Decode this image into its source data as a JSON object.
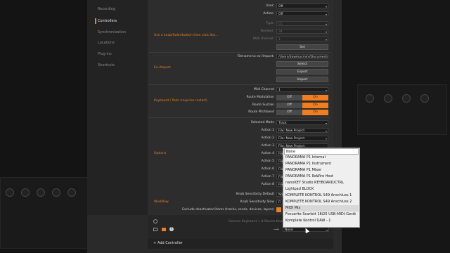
{
  "sidebar": {
    "items": [
      {
        "label": "Recording",
        "active": false
      },
      {
        "label": "Controllers",
        "active": true
      },
      {
        "label": "Synchronization",
        "active": false
      },
      {
        "label": "Locations",
        "active": false
      },
      {
        "label": "Plug-ins",
        "active": false
      },
      {
        "label": "Shortcuts",
        "active": false
      }
    ]
  },
  "learn": {
    "section": "Use a knob/fader/button then click Set...",
    "user_label": "User:",
    "user_value": "Off",
    "action_label": "Action:",
    "action_value": "Off",
    "type_label": "Type:",
    "type_value": "CC",
    "number_label": "Number:",
    "number_value": "34",
    "channel_label": "Midi channel:",
    "channel_value": "1",
    "set_button": "Set"
  },
  "exim": {
    "section": "Ex-/Import",
    "filename_label": "Filename to ex-/import:",
    "filename_value": "/Users/dawmacmini/Documents/",
    "select_button": "Select",
    "export_button": "Export",
    "import_button": "Import"
  },
  "keyboard": {
    "section": "Keyboard / Pads (requires restart)",
    "midi_channel_label": "Midi Channel",
    "midi_channel_value": "1",
    "rows": [
      {
        "label": "Route Modulation",
        "off": "Off",
        "on": "On"
      },
      {
        "label": "Route Sustain",
        "off": "Off",
        "on": "On"
      },
      {
        "label": "Route Pitchbend",
        "off": "Off",
        "on": "On"
      }
    ]
  },
  "options": {
    "section": "Options",
    "mode_label": "Selected Mode",
    "mode_value": "Track",
    "actions": [
      {
        "label": "Action 1",
        "value": "File: New Project"
      },
      {
        "label": "Action 2",
        "value": "File: New Project"
      },
      {
        "label": "Action 3",
        "value": "File: New Project"
      },
      {
        "label": "Action 4",
        "value": "File"
      },
      {
        "label": "Action 5",
        "value": "File"
      },
      {
        "label": "Action 6",
        "value": "File"
      },
      {
        "label": "Action 7",
        "value": "File"
      },
      {
        "label": "Action 8",
        "value": "File"
      }
    ],
    "knob_default_label": "Knob Sensitivity Default",
    "knob_default_value": "No",
    "knob_slow_label": "Knob Sensitivity Slow",
    "knob_slow_value": "Fi"
  },
  "workflow": {
    "section": "Workflow",
    "exclude_label": "Exclude deactivated items (tracks, sends, devices, layers)"
  },
  "footer": {
    "generic_text": "Generic Keyboard + 8 Device Knob",
    "port_value": "None",
    "add_controller": "Add Controller"
  },
  "popup": {
    "items": [
      "None",
      "PANORAMA P1 Internal",
      "PANORAMA P1 Instrument",
      "PANORAMA P1 Mixer",
      "PANORAMA P1 ReWire Host",
      "nanoKEY Studio KEYBOARD/CTRL",
      "Lightpad BLOCK",
      "KOMPLETE KONTROL S49 Anschluss 1",
      "KOMPLETE KONTROL S49 Anschluss 2",
      "MIDI Mix",
      "Focusrite Scarlett 18i20 USB-MIDI-Gerät",
      "Komplete Kontrol DAW - 1"
    ]
  },
  "colors": {
    "accent": "#f07e1f",
    "background": "#2d2d2d"
  }
}
